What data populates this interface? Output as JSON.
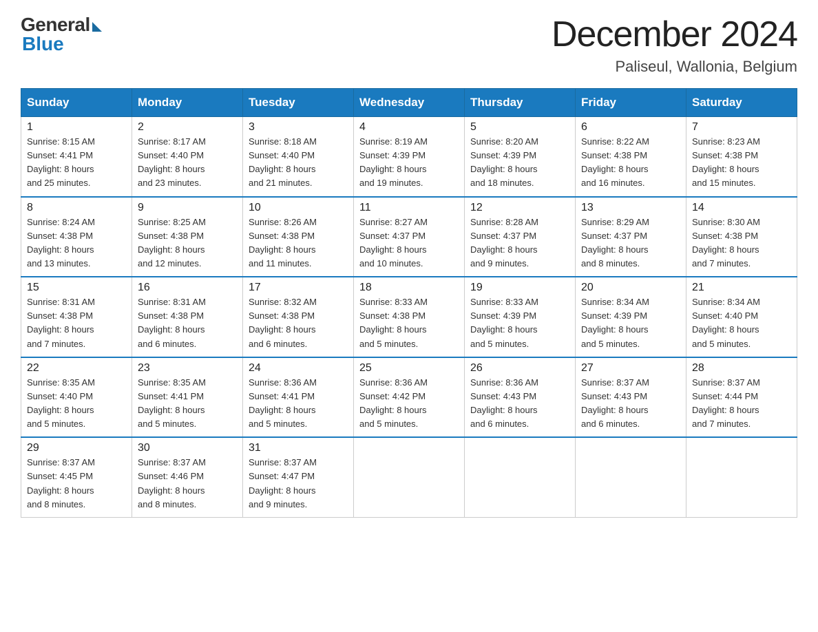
{
  "logo": {
    "general": "General",
    "blue": "Blue"
  },
  "title": "December 2024",
  "location": "Paliseul, Wallonia, Belgium",
  "weekdays": [
    "Sunday",
    "Monday",
    "Tuesday",
    "Wednesday",
    "Thursday",
    "Friday",
    "Saturday"
  ],
  "weeks": [
    [
      {
        "day": "1",
        "sunrise": "8:15 AM",
        "sunset": "4:41 PM",
        "daylight": "8 hours and 25 minutes."
      },
      {
        "day": "2",
        "sunrise": "8:17 AM",
        "sunset": "4:40 PM",
        "daylight": "8 hours and 23 minutes."
      },
      {
        "day": "3",
        "sunrise": "8:18 AM",
        "sunset": "4:40 PM",
        "daylight": "8 hours and 21 minutes."
      },
      {
        "day": "4",
        "sunrise": "8:19 AM",
        "sunset": "4:39 PM",
        "daylight": "8 hours and 19 minutes."
      },
      {
        "day": "5",
        "sunrise": "8:20 AM",
        "sunset": "4:39 PM",
        "daylight": "8 hours and 18 minutes."
      },
      {
        "day": "6",
        "sunrise": "8:22 AM",
        "sunset": "4:38 PM",
        "daylight": "8 hours and 16 minutes."
      },
      {
        "day": "7",
        "sunrise": "8:23 AM",
        "sunset": "4:38 PM",
        "daylight": "8 hours and 15 minutes."
      }
    ],
    [
      {
        "day": "8",
        "sunrise": "8:24 AM",
        "sunset": "4:38 PM",
        "daylight": "8 hours and 13 minutes."
      },
      {
        "day": "9",
        "sunrise": "8:25 AM",
        "sunset": "4:38 PM",
        "daylight": "8 hours and 12 minutes."
      },
      {
        "day": "10",
        "sunrise": "8:26 AM",
        "sunset": "4:38 PM",
        "daylight": "8 hours and 11 minutes."
      },
      {
        "day": "11",
        "sunrise": "8:27 AM",
        "sunset": "4:37 PM",
        "daylight": "8 hours and 10 minutes."
      },
      {
        "day": "12",
        "sunrise": "8:28 AM",
        "sunset": "4:37 PM",
        "daylight": "8 hours and 9 minutes."
      },
      {
        "day": "13",
        "sunrise": "8:29 AM",
        "sunset": "4:37 PM",
        "daylight": "8 hours and 8 minutes."
      },
      {
        "day": "14",
        "sunrise": "8:30 AM",
        "sunset": "4:38 PM",
        "daylight": "8 hours and 7 minutes."
      }
    ],
    [
      {
        "day": "15",
        "sunrise": "8:31 AM",
        "sunset": "4:38 PM",
        "daylight": "8 hours and 7 minutes."
      },
      {
        "day": "16",
        "sunrise": "8:31 AM",
        "sunset": "4:38 PM",
        "daylight": "8 hours and 6 minutes."
      },
      {
        "day": "17",
        "sunrise": "8:32 AM",
        "sunset": "4:38 PM",
        "daylight": "8 hours and 6 minutes."
      },
      {
        "day": "18",
        "sunrise": "8:33 AM",
        "sunset": "4:38 PM",
        "daylight": "8 hours and 5 minutes."
      },
      {
        "day": "19",
        "sunrise": "8:33 AM",
        "sunset": "4:39 PM",
        "daylight": "8 hours and 5 minutes."
      },
      {
        "day": "20",
        "sunrise": "8:34 AM",
        "sunset": "4:39 PM",
        "daylight": "8 hours and 5 minutes."
      },
      {
        "day": "21",
        "sunrise": "8:34 AM",
        "sunset": "4:40 PM",
        "daylight": "8 hours and 5 minutes."
      }
    ],
    [
      {
        "day": "22",
        "sunrise": "8:35 AM",
        "sunset": "4:40 PM",
        "daylight": "8 hours and 5 minutes."
      },
      {
        "day": "23",
        "sunrise": "8:35 AM",
        "sunset": "4:41 PM",
        "daylight": "8 hours and 5 minutes."
      },
      {
        "day": "24",
        "sunrise": "8:36 AM",
        "sunset": "4:41 PM",
        "daylight": "8 hours and 5 minutes."
      },
      {
        "day": "25",
        "sunrise": "8:36 AM",
        "sunset": "4:42 PM",
        "daylight": "8 hours and 5 minutes."
      },
      {
        "day": "26",
        "sunrise": "8:36 AM",
        "sunset": "4:43 PM",
        "daylight": "8 hours and 6 minutes."
      },
      {
        "day": "27",
        "sunrise": "8:37 AM",
        "sunset": "4:43 PM",
        "daylight": "8 hours and 6 minutes."
      },
      {
        "day": "28",
        "sunrise": "8:37 AM",
        "sunset": "4:44 PM",
        "daylight": "8 hours and 7 minutes."
      }
    ],
    [
      {
        "day": "29",
        "sunrise": "8:37 AM",
        "sunset": "4:45 PM",
        "daylight": "8 hours and 8 minutes."
      },
      {
        "day": "30",
        "sunrise": "8:37 AM",
        "sunset": "4:46 PM",
        "daylight": "8 hours and 8 minutes."
      },
      {
        "day": "31",
        "sunrise": "8:37 AM",
        "sunset": "4:47 PM",
        "daylight": "8 hours and 9 minutes."
      },
      null,
      null,
      null,
      null
    ]
  ],
  "labels": {
    "sunrise": "Sunrise:",
    "sunset": "Sunset:",
    "daylight": "Daylight:"
  }
}
